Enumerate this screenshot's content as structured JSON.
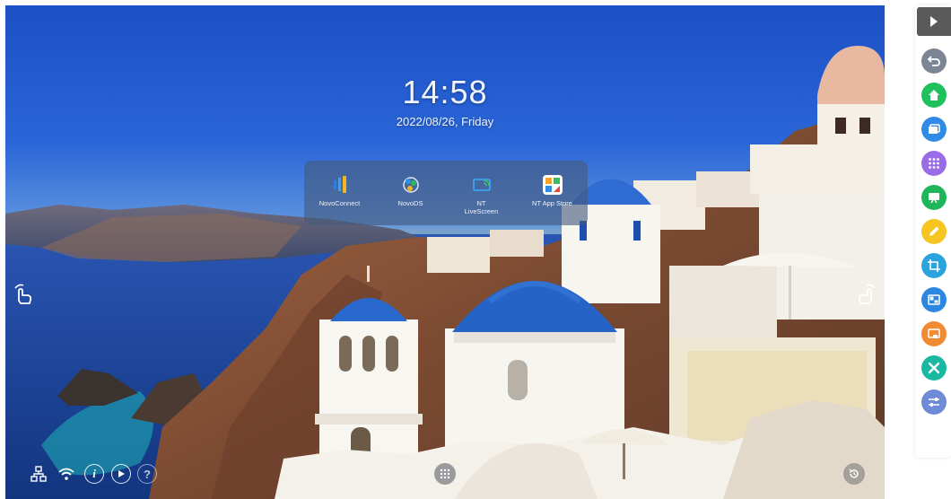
{
  "clock": {
    "time": "14:58",
    "date": "2022/08/26, Friday"
  },
  "dock": {
    "apps": [
      {
        "label": "NovoConnect",
        "icon": "novoconnect-icon"
      },
      {
        "label": "NovoDS",
        "icon": "novods-icon"
      },
      {
        "label": "NT\nLiveScreen",
        "icon": "nt-livescreen-icon"
      },
      {
        "label": "NT App Store",
        "icon": "nt-app-store-icon"
      }
    ]
  },
  "status_bar": [
    "network-icon",
    "wifi-icon",
    "info-icon",
    "play-icon",
    "help-icon"
  ],
  "toolbar": {
    "collapse_icon": "triangle-right-icon",
    "buttons": [
      {
        "name": "back-button",
        "icon": "back-arrow-icon",
        "color": "#7b8594"
      },
      {
        "name": "home-button",
        "icon": "home-icon",
        "color": "#1fc15c"
      },
      {
        "name": "windows-button",
        "icon": "windows-icon",
        "color": "#2f8be6"
      },
      {
        "name": "apps-button",
        "icon": "apps-grid-icon",
        "color": "#9a6ce8"
      },
      {
        "name": "whiteboard-button",
        "icon": "whiteboard-icon",
        "color": "#1fb65a"
      },
      {
        "name": "annotate-button",
        "icon": "pencil-icon",
        "color": "#f6c521"
      },
      {
        "name": "screenshot-button",
        "icon": "crop-icon",
        "color": "#2ba4dd"
      },
      {
        "name": "split-screen-button",
        "icon": "split-screen-icon",
        "color": "#2c87e0"
      },
      {
        "name": "source-button",
        "icon": "source-input-icon",
        "color": "#f08a33"
      },
      {
        "name": "tools-button",
        "icon": "tools-icon",
        "color": "#19b8a0"
      },
      {
        "name": "settings-button",
        "icon": "sliders-icon",
        "color": "#6f8bd6"
      }
    ]
  },
  "colors": {
    "sky": "#1c50c4",
    "sea": "#1a3f8f",
    "dome": "#2563c9",
    "dock_bg": "rgba(70,90,125,0.62)",
    "toolbar_bg": "#ffffff"
  }
}
